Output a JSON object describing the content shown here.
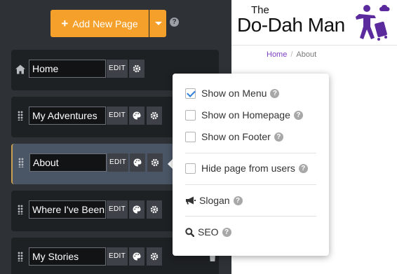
{
  "toolbar": {
    "add_page_label": "Add New Page",
    "help_icon": "question-icon"
  },
  "pages": [
    {
      "name": "Home",
      "edit_label": "EDIT",
      "icon": "home-icon"
    },
    {
      "name": "My Adventures",
      "edit_label": "EDIT",
      "icon": "drag-grip-icon"
    },
    {
      "name": "About",
      "edit_label": "EDIT",
      "icon": "drag-grip-icon",
      "active": true
    },
    {
      "name": "Where I've Been",
      "edit_label": "EDIT",
      "icon": "drag-grip-icon"
    },
    {
      "name": "My Stories",
      "edit_label": "EDIT",
      "icon": "drag-grip-icon"
    }
  ],
  "logo": {
    "line1": "The",
    "line2": "Do-Dah Man"
  },
  "breadcrumb": {
    "home": "Home",
    "separator": "/",
    "current": "About"
  },
  "popover": {
    "show_on_menu": {
      "label": "Show on Menu",
      "checked": true
    },
    "show_on_homepage": {
      "label": "Show on Homepage",
      "checked": false
    },
    "show_on_footer": {
      "label": "Show on Footer",
      "checked": false
    },
    "hide_from_users": {
      "label": "Hide page from users",
      "checked": false
    },
    "slogan_label": "Slogan",
    "seo_label": "SEO"
  },
  "colors": {
    "accent": "#f5a02a",
    "panel": "#2e3236",
    "row": "#1e2124",
    "active_row": "#4a5565",
    "link": "#7b3fc4",
    "check": "#2f7fd6"
  }
}
